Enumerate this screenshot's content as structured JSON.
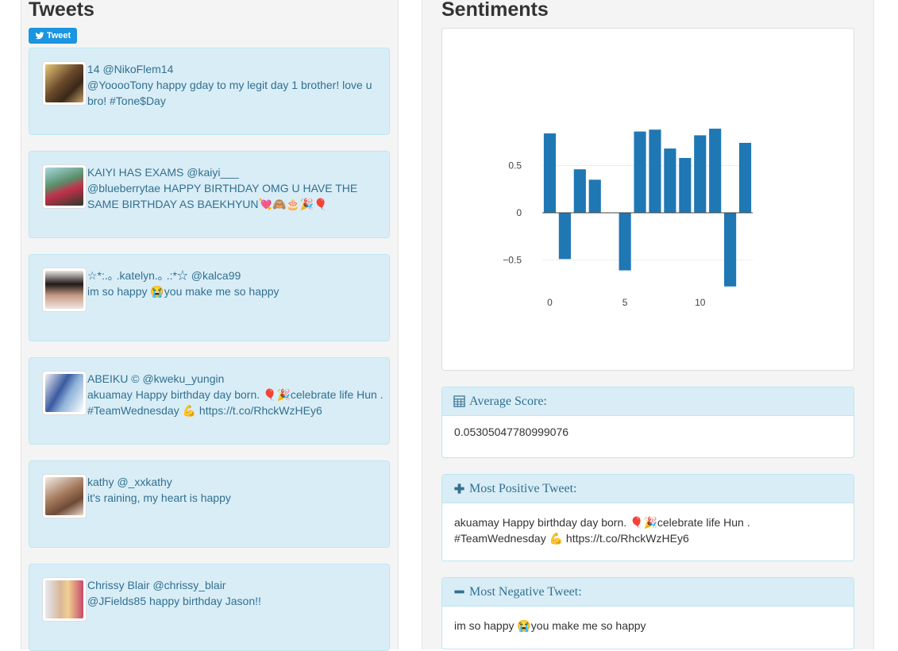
{
  "tweets_panel": {
    "title": "Tweets",
    "tweet_button_label": "Tweet"
  },
  "tweets": [
    {
      "user": "14 @NikoFlem14",
      "text": "@YooooTony happy gday to my legit day 1 brother! love u bro! #Tone$Day"
    },
    {
      "user": "KAIYI HAS EXAMS @kaiyi___",
      "text": "@blueberrytae HAPPY BIRTHDAY OMG U HAVE THE SAME BIRTHDAY AS BAEKHYUN💘🙈🎂🎉🎈"
    },
    {
      "user": "☆*:.｡ .katelyn.｡ .:*☆ @kalca99",
      "text": "im so happy 😭you make me so happy"
    },
    {
      "user": "ABEIKU © @kweku_yungin",
      "text": "akuamay Happy birthday day born. 🎈🎉celebrate life Hun . #TeamWednesday 💪 https://t.co/RhckWzHEy6"
    },
    {
      "user": "kathy @_xxkathy",
      "text": "it's raining, my heart is happy"
    },
    {
      "user": "Chrissy Blair @chrissy_blair",
      "text": "@JFields85 happy birthday Jason!!"
    }
  ],
  "sentiments_panel": {
    "title": "Sentiments"
  },
  "chart_data": {
    "type": "bar",
    "x": [
      0,
      1,
      2,
      3,
      4,
      5,
      6,
      7,
      8,
      9,
      10,
      11,
      12,
      13
    ],
    "values": [
      0.84,
      -0.49,
      0.46,
      0.35,
      0,
      -0.61,
      0.86,
      0.88,
      0.68,
      0.58,
      0.82,
      0.89,
      -0.78,
      0.74
    ],
    "xticks": [
      "0",
      "5",
      "10"
    ],
    "yticks": [
      "0.5",
      "0",
      "−0.5"
    ],
    "ylim": [
      -0.85,
      0.92
    ],
    "bar_color": "#1f77b4",
    "grid": true
  },
  "average": {
    "label": "Average Score:",
    "value": "0.05305047780999076"
  },
  "most_positive": {
    "label": "Most Positive Tweet:",
    "text": "akuamay Happy birthday day born. 🎈🎉celebrate life Hun . #TeamWednesday 💪 https://t.co/RhckWzHEy6"
  },
  "most_negative": {
    "label": "Most Negative Tweet:",
    "text": "im so happy 😭you make me so happy"
  },
  "colors": {
    "panel_info_bg": "#d9edf7",
    "panel_info_text": "#31708f",
    "twitter_blue": "#1b95e0"
  }
}
